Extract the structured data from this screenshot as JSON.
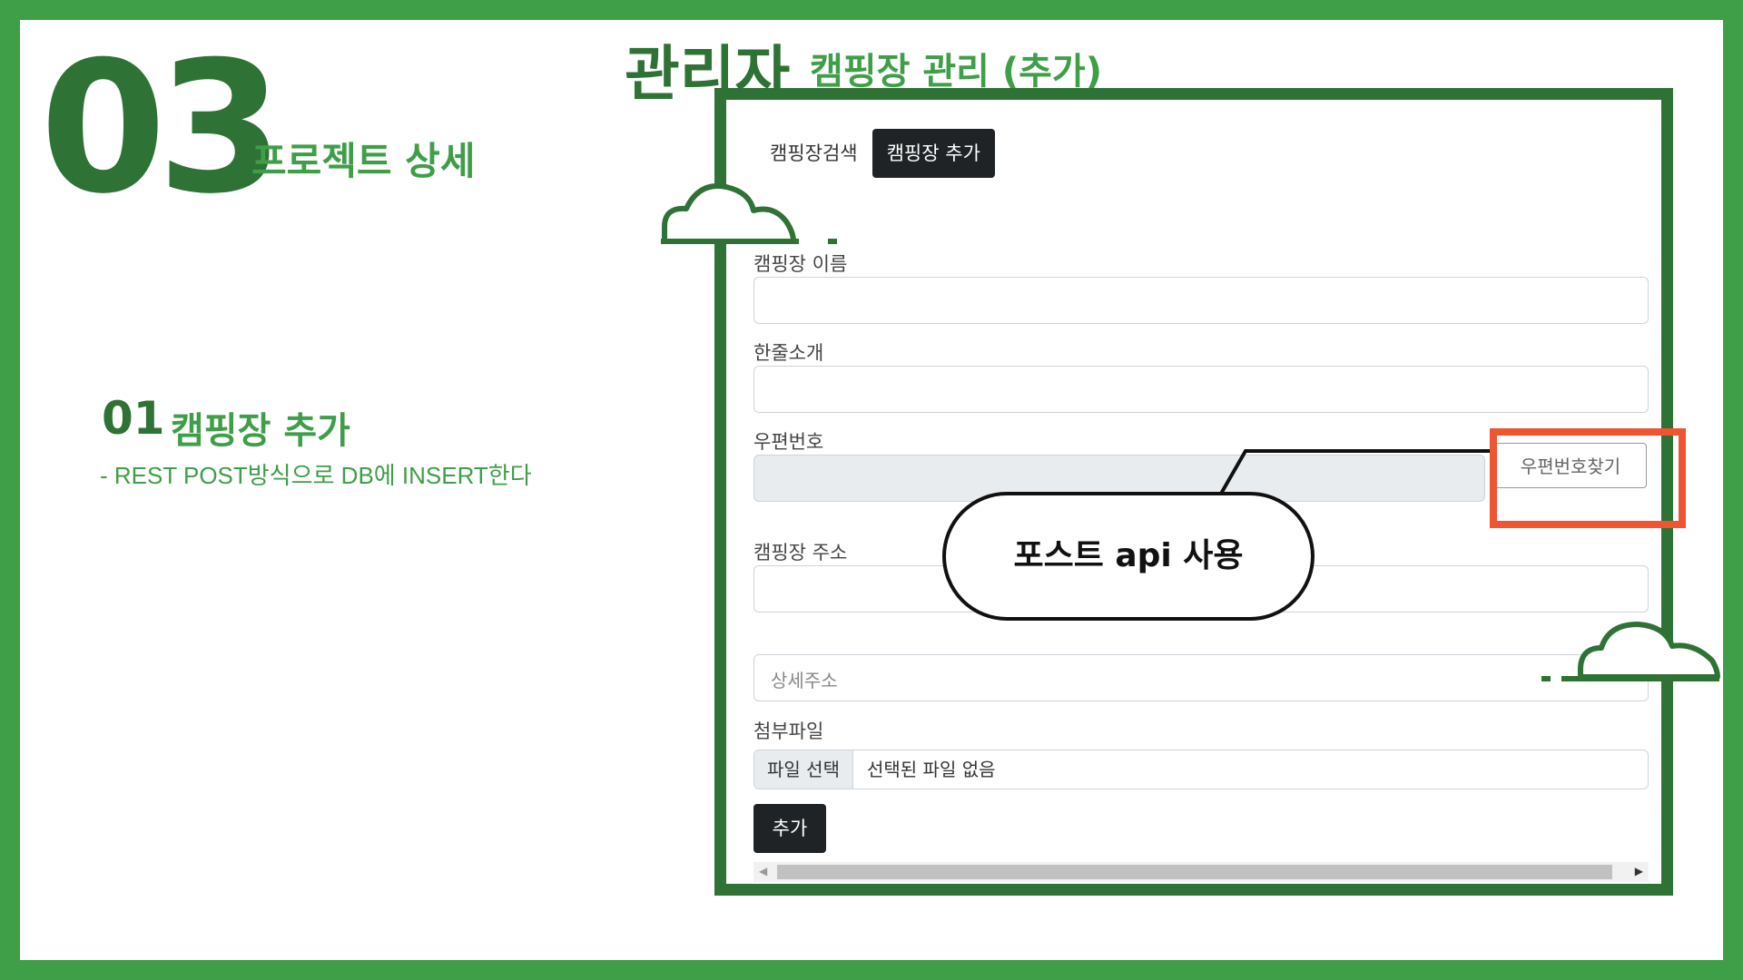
{
  "slide": {
    "number": "03",
    "subtitle": "프로젝트 상세",
    "header_main": "관리자",
    "header_sub": "캠핑장 관리 (추가)"
  },
  "section": {
    "number": "01",
    "title": "캠핑장 추가",
    "description": "- REST POST방식으로  DB에 INSERT한다"
  },
  "screenshot": {
    "tabs": [
      {
        "label": "캠핑장검색",
        "active": false
      },
      {
        "label": "캠핑장 추가",
        "active": true
      }
    ],
    "form": {
      "name_label": "캠핑장 이름",
      "intro_label": "한줄소개",
      "zip_label": "우편번호",
      "zip_button": "우편번호찾기",
      "address_label": "캠핑장 주소",
      "detail_placeholder": "상세주소",
      "attach_label": "첨부파일",
      "file_button": "파일 선택",
      "file_status": "선택된 파일 없음",
      "submit": "추가"
    }
  },
  "annotation": {
    "bubble_text": "포스트 api 사용",
    "highlight_color": "#ef5530"
  },
  "colors": {
    "border_green": "#3f9e48",
    "dark_green": "#2e7236",
    "dark_button": "#1f2326"
  }
}
